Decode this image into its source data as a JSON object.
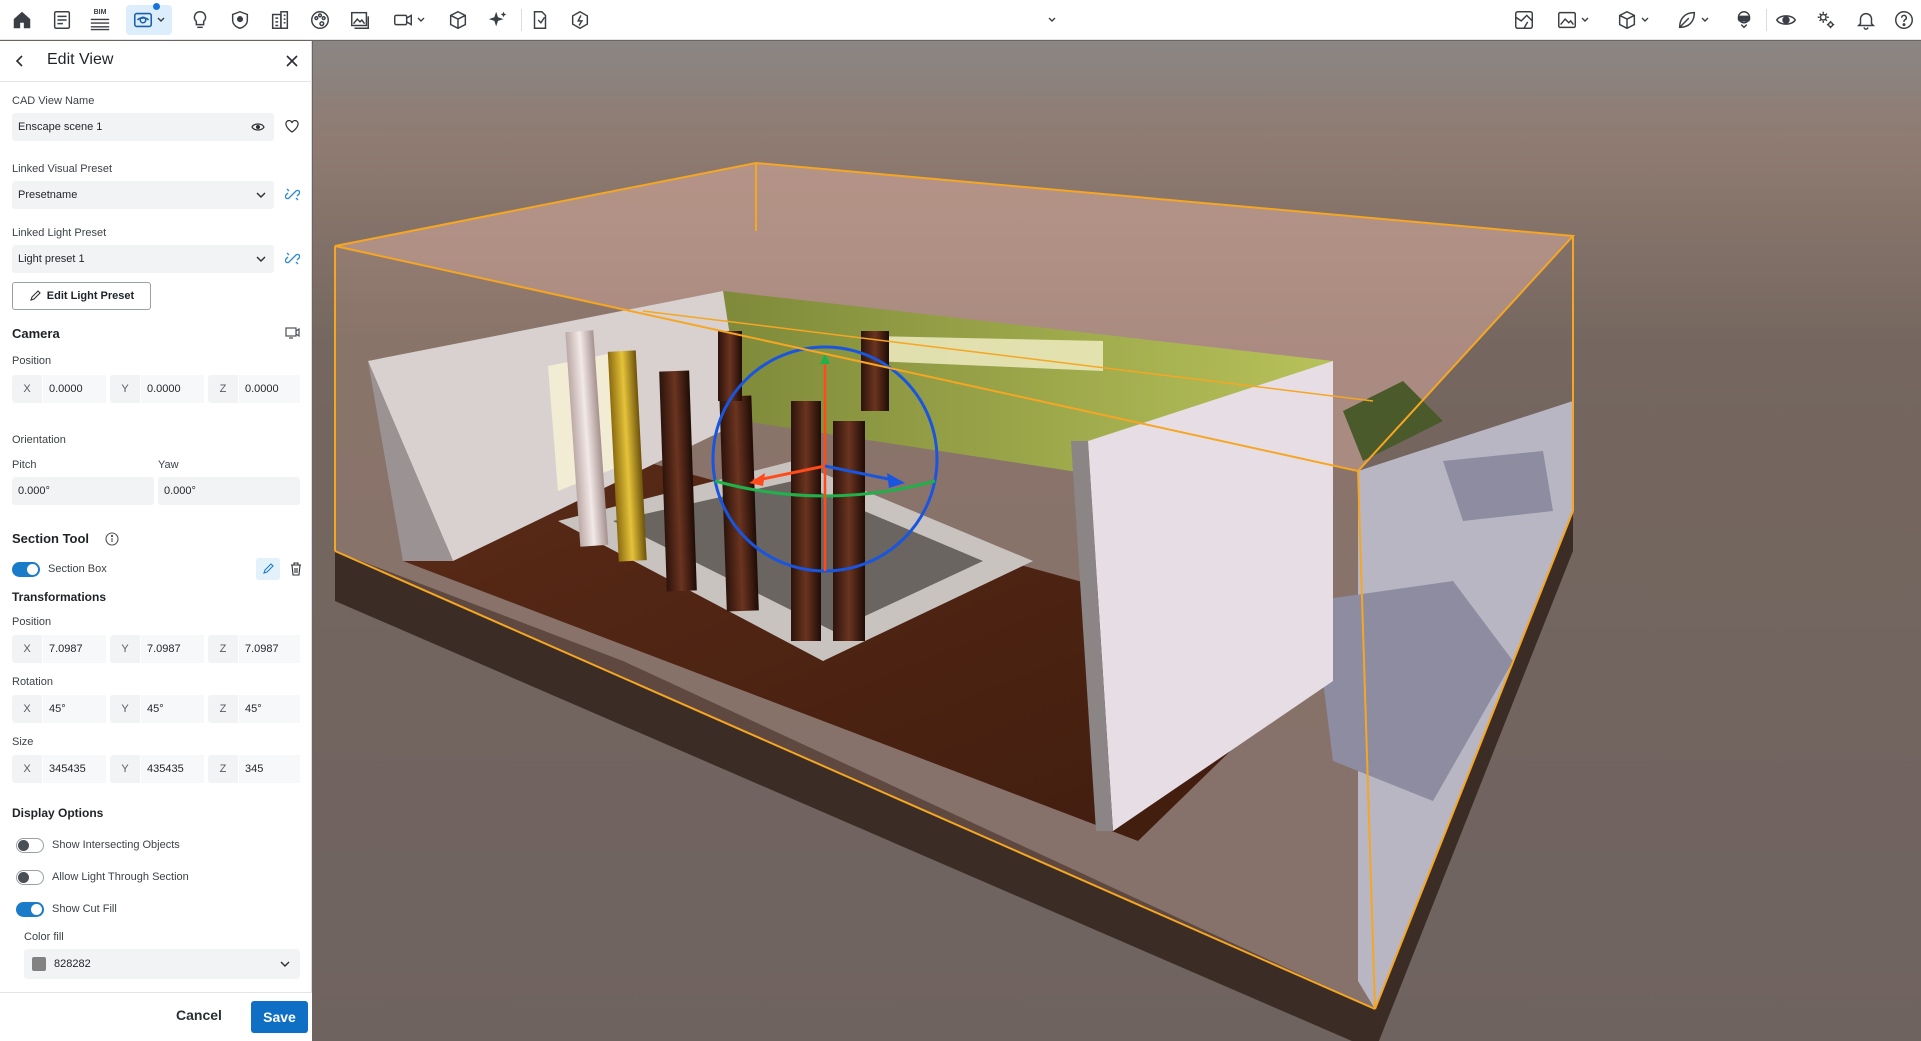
{
  "toolbar": {
    "bim_label": "BIM",
    "left_icons": [
      "home-icon",
      "document-icon",
      "bim-icon",
      "view-icon",
      "lightbulb-icon",
      "shield-icon",
      "building-icon",
      "palette-icon",
      "image-icon",
      "camera-icon",
      "cube-icon",
      "sparkle-icon",
      "file-icon",
      "asset-icon"
    ],
    "right_icons": [
      "map-icon",
      "image-icon",
      "cube-icon",
      "leaf-icon",
      "vr-headset-icon",
      "eye-icon",
      "settings-icon",
      "bell-icon",
      "help-icon"
    ],
    "accent": "#1a73d9"
  },
  "panel": {
    "title": "Edit View",
    "cad_view_label": "CAD View Name",
    "cad_view_value": "Enscape scene 1",
    "visual_preset_label": "Linked Visual Preset",
    "visual_preset_value": "Presetname",
    "light_preset_label": "Linked Light Preset",
    "light_preset_value": "Light preset 1",
    "edit_light_button": "Edit Light Preset",
    "camera": {
      "heading": "Camera",
      "position_label": "Position",
      "position": [
        {
          "axis": "X",
          "value": "0.0000"
        },
        {
          "axis": "Y",
          "value": "0.0000"
        },
        {
          "axis": "Z",
          "value": "0.0000"
        }
      ],
      "orientation_label": "Orientation",
      "pitch_label": "Pitch",
      "pitch_value": "0.000°",
      "yaw_label": "Yaw",
      "yaw_value": "0.000°"
    },
    "section_tool": {
      "heading": "Section Tool",
      "section_box_label": "Section Box",
      "section_box_on": true,
      "transformations_heading": "Transformations",
      "position_label": "Position",
      "position": [
        {
          "axis": "X",
          "value": "7.0987"
        },
        {
          "axis": "Y",
          "value": "7.0987"
        },
        {
          "axis": "Z",
          "value": "7.0987"
        }
      ],
      "rotation_label": "Rotation",
      "rotation": [
        {
          "axis": "X",
          "value": "45°"
        },
        {
          "axis": "Y",
          "value": "45°"
        },
        {
          "axis": "Z",
          "value": "45°"
        }
      ],
      "size_label": "Size",
      "size": [
        {
          "axis": "X",
          "value": "345435"
        },
        {
          "axis": "Y",
          "value": "435435"
        },
        {
          "axis": "Z",
          "value": "345"
        }
      ]
    },
    "display_options": {
      "heading": "Display Options",
      "show_intersecting_label": "Show Intersecting Objects",
      "show_intersecting_on": false,
      "allow_light_label": "Allow Light Through Section",
      "allow_light_on": false,
      "show_cut_fill_label": "Show Cut Fill",
      "show_cut_fill_on": true,
      "color_fill_label": "Color fill",
      "color_fill_value": "828282",
      "color_fill_swatch": "#828282"
    },
    "cancel_label": "Cancel",
    "save_label": "Save",
    "save_color": "#0f6fc4"
  },
  "viewport": {
    "section_box_color": "#f5a623"
  }
}
